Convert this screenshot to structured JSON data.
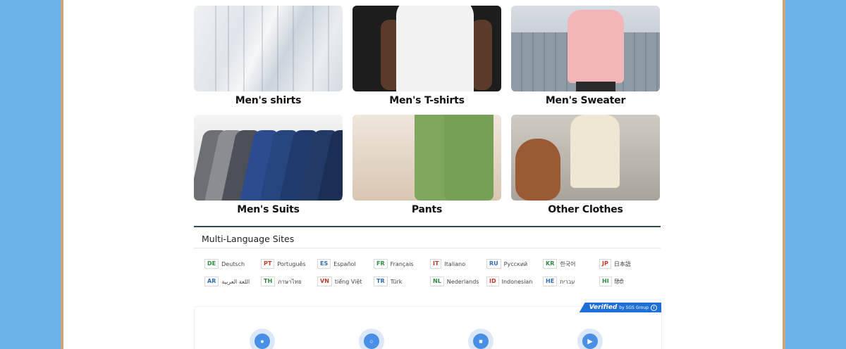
{
  "categories": [
    {
      "label": "Men's shirts"
    },
    {
      "label": "Men's T-shirts"
    },
    {
      "label": "Men's Sweater"
    },
    {
      "label": "Men's Suits"
    },
    {
      "label": "Pants"
    },
    {
      "label": "Other Clothes"
    }
  ],
  "languages": {
    "title": "Multi-Language Sites",
    "items": [
      {
        "code": "DE",
        "name": "Deutsch",
        "color": "#2e8b3e"
      },
      {
        "code": "PT",
        "name": "Português",
        "color": "#c0392b"
      },
      {
        "code": "ES",
        "name": "Español",
        "color": "#2a6db0"
      },
      {
        "code": "FR",
        "name": "Français",
        "color": "#2e8b3e"
      },
      {
        "code": "IT",
        "name": "Italiano",
        "color": "#c0392b"
      },
      {
        "code": "RU",
        "name": "Русский",
        "color": "#2a6db0"
      },
      {
        "code": "KR",
        "name": "한국어",
        "color": "#2e8b3e"
      },
      {
        "code": "JP",
        "name": "日本語",
        "color": "#c0392b"
      },
      {
        "code": "AR",
        "name": "اللغة العربية",
        "color": "#2a6db0"
      },
      {
        "code": "TH",
        "name": "ภาษาไทย",
        "color": "#2e8b3e"
      },
      {
        "code": "VN",
        "name": "tiếng Việt",
        "color": "#c0392b"
      },
      {
        "code": "TR",
        "name": "Türk",
        "color": "#2a6db0"
      },
      {
        "code": "NL",
        "name": "Nederlands",
        "color": "#2e8b3e"
      },
      {
        "code": "ID",
        "name": "Indonesian",
        "color": "#c0392b"
      },
      {
        "code": "HE",
        "name": "עברית",
        "color": "#2a6db0"
      },
      {
        "code": "HI",
        "name": "हिंदी",
        "color": "#2e8b3e"
      }
    ]
  },
  "verified": {
    "label": "Verified",
    "by": "by SGS Group",
    "features": [
      {
        "icon": "user-gear-icon"
      },
      {
        "icon": "oem-icon"
      },
      {
        "icon": "factory-icon"
      },
      {
        "icon": "export-icon"
      }
    ]
  }
}
